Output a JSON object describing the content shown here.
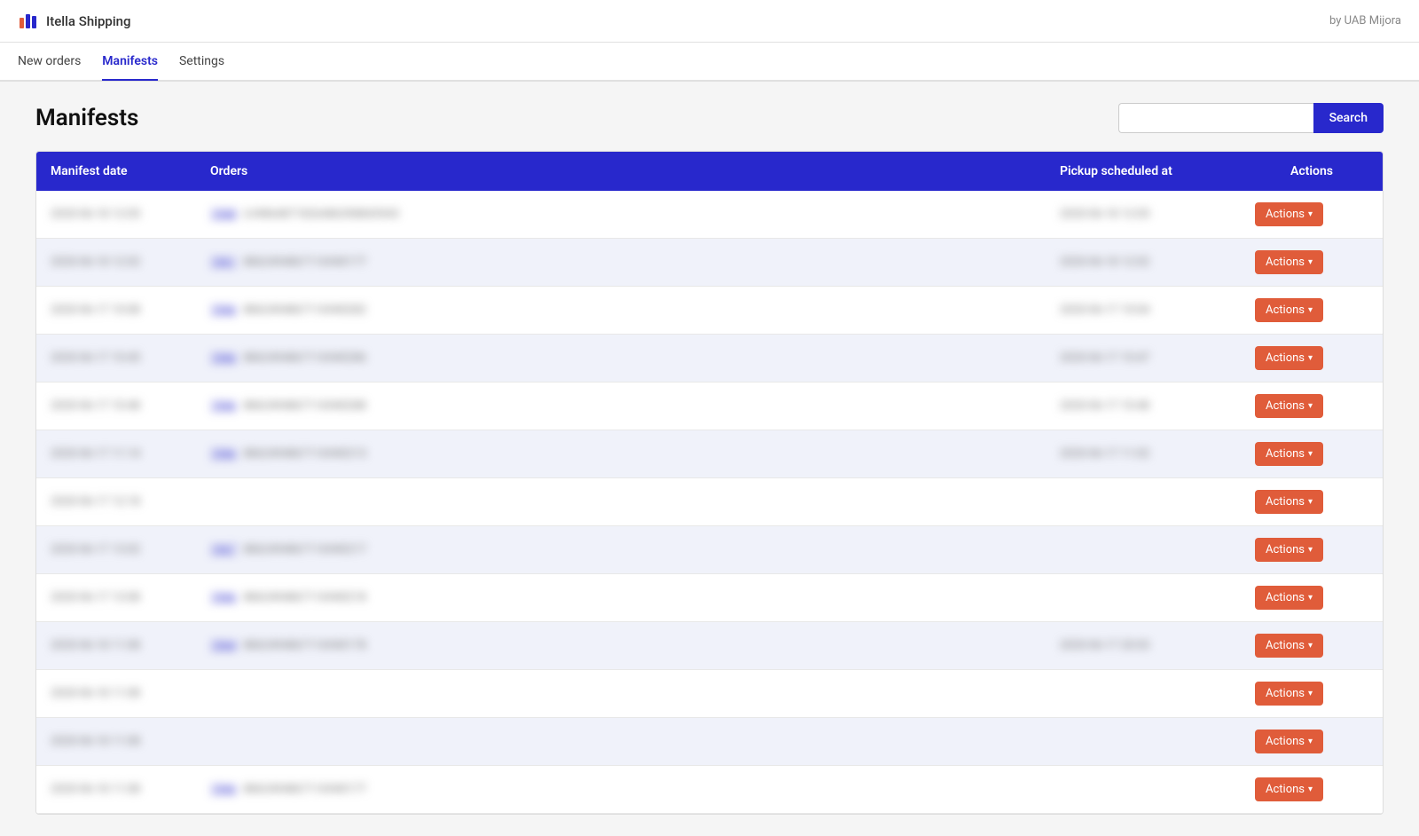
{
  "app": {
    "brand": "Itella Shipping",
    "credit": "by UAB Mijora"
  },
  "nav": {
    "items": [
      {
        "label": "New orders",
        "active": false
      },
      {
        "label": "Manifests",
        "active": true
      },
      {
        "label": "Settings",
        "active": false
      }
    ]
  },
  "page": {
    "title": "Manifests",
    "search_placeholder": "",
    "search_button": "Search"
  },
  "table": {
    "headers": [
      "Manifest date",
      "Orders",
      "Pickup scheduled at",
      "Actions"
    ],
    "rows": [
      {
        "date": "2020-06-18 12:05",
        "orders_count": "1068",
        "orders_text": "LV#864871826486398843943",
        "pickup": "2020-06-18 12:05",
        "has_pickup": true
      },
      {
        "date": "2020-06-18 12:02",
        "orders_count": "1061",
        "orders_text": "8862494867116940177",
        "pickup": "2020-06-18 12:02",
        "has_pickup": true
      },
      {
        "date": "2020-06-17 10:08",
        "orders_count": "1066",
        "orders_text": "8862494867116940282",
        "pickup": "2020-06-17 10:04",
        "has_pickup": true
      },
      {
        "date": "2020-06-17 10:45",
        "orders_count": "1066",
        "orders_text": "8862494867116940286",
        "pickup": "2020-06-17 10:47",
        "has_pickup": true
      },
      {
        "date": "2020-06-17 10:48",
        "orders_count": "1066",
        "orders_text": "8862494867116940288",
        "pickup": "2020-06-17 10:48",
        "has_pickup": true
      },
      {
        "date": "2020-06-17 11:14",
        "orders_count": "1066",
        "orders_text": "8862494867116940213",
        "pickup": "2020-06-17 11:02",
        "has_pickup": true
      },
      {
        "date": "2020-06-17 12:18",
        "orders_count": "",
        "orders_text": "",
        "pickup": "",
        "has_pickup": false
      },
      {
        "date": "2020-06-17 13:02",
        "orders_count": "1067",
        "orders_text": "8862494867116940217",
        "pickup": "",
        "has_pickup": false
      },
      {
        "date": "2020-06-17 13:08",
        "orders_count": "1066",
        "orders_text": "8862494867116940218",
        "pickup": "",
        "has_pickup": false
      },
      {
        "date": "2020-06-18 11:08",
        "orders_count": "1064",
        "orders_text": "8862494867116940178",
        "pickup": "2020-06-17 20:03",
        "has_pickup": true
      },
      {
        "date": "2020-06-18 11:08",
        "orders_count": "",
        "orders_text": "",
        "pickup": "",
        "has_pickup": false
      },
      {
        "date": "2020-06-18 11:08",
        "orders_count": "",
        "orders_text": "",
        "pickup": "",
        "has_pickup": false
      },
      {
        "date": "2020-06-18 11:08",
        "orders_count": "1066",
        "orders_text": "8862494867116940177",
        "pickup": "",
        "has_pickup": false
      }
    ],
    "actions_label": "Actions ▾"
  }
}
